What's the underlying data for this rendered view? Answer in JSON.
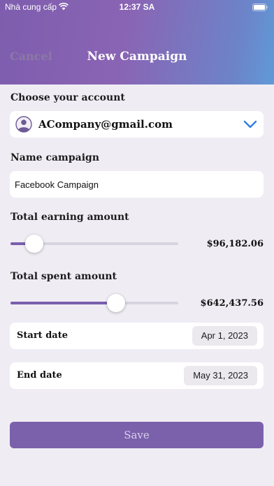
{
  "status_bar": {
    "carrier": "Nhà cung cấp",
    "time": "12:37 SA"
  },
  "nav": {
    "cancel_label": "Cancel",
    "title": "New Campaign"
  },
  "account": {
    "section_label": "Choose your account",
    "email": "ACompany@gmail.com"
  },
  "campaign_name": {
    "section_label": "Name campaign",
    "value": "Facebook Campaign"
  },
  "earning": {
    "section_label": "Total earning amount",
    "amount": "$96,182.06",
    "slider_fraction": 0.14
  },
  "spent": {
    "section_label": "Total spent amount",
    "amount": "$642,437.56",
    "slider_fraction": 0.63
  },
  "start_date": {
    "label": "Start date",
    "value": "Apr 1, 2023"
  },
  "end_date": {
    "label": "End date",
    "value": "May 31, 2023"
  },
  "save_label": "Save",
  "colors": {
    "accent": "#7b61ab",
    "header_start": "#7e5dae",
    "header_end": "#5f9ad8",
    "chevron": "#2f7de1"
  }
}
